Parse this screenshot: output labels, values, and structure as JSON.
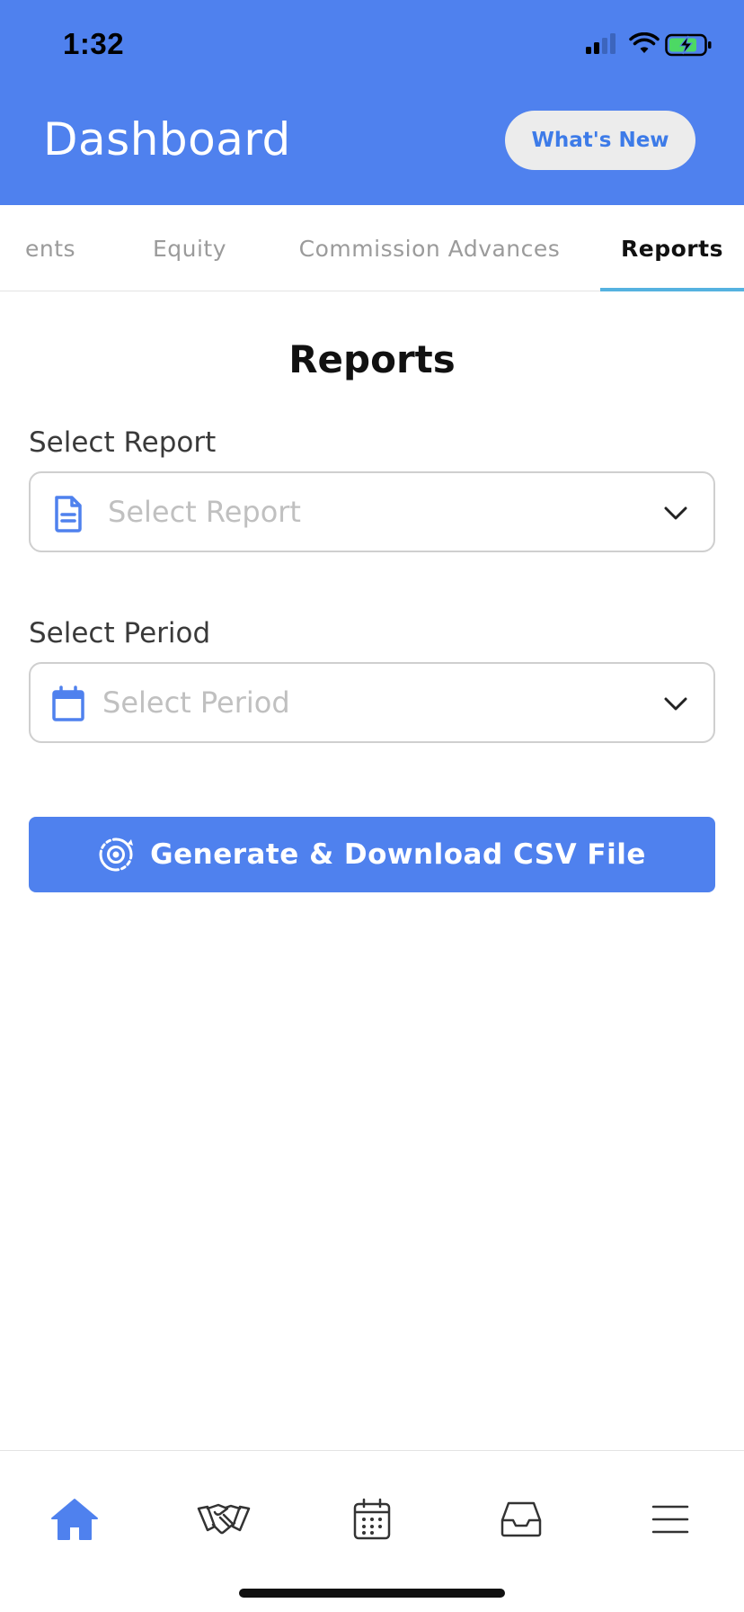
{
  "status_bar": {
    "time": "1:32",
    "icons": [
      "cellular-signal-icon",
      "wifi-icon",
      "battery-charging-icon"
    ]
  },
  "header": {
    "title": "Dashboard",
    "whats_new_label": "What's New"
  },
  "tabs": [
    {
      "label": "ents",
      "active": false
    },
    {
      "label": "Equity",
      "active": false
    },
    {
      "label": "Commission Advances",
      "active": false
    },
    {
      "label": "Reports",
      "active": true
    }
  ],
  "main": {
    "title": "Reports",
    "report_field": {
      "label": "Select Report",
      "placeholder": "Select Report",
      "value": "",
      "icon": "document-icon"
    },
    "period_field": {
      "label": "Select Period",
      "placeholder": "Select Period",
      "value": "",
      "icon": "calendar-icon"
    },
    "generate_button": {
      "label": "Generate & Download CSV File",
      "icon": "refresh-gear-icon"
    }
  },
  "bottom_nav": {
    "items": [
      {
        "icon": "home-icon",
        "active": true
      },
      {
        "icon": "handshake-icon",
        "active": false
      },
      {
        "icon": "calendar-icon",
        "active": false
      },
      {
        "icon": "inbox-icon",
        "active": false
      },
      {
        "icon": "menu-icon",
        "active": false
      }
    ]
  },
  "colors": {
    "brand": "#4f81ee",
    "tab_underline": "#55b2e0",
    "whats_new_text": "#3d7be8",
    "battery_fill": "#4cd964"
  }
}
